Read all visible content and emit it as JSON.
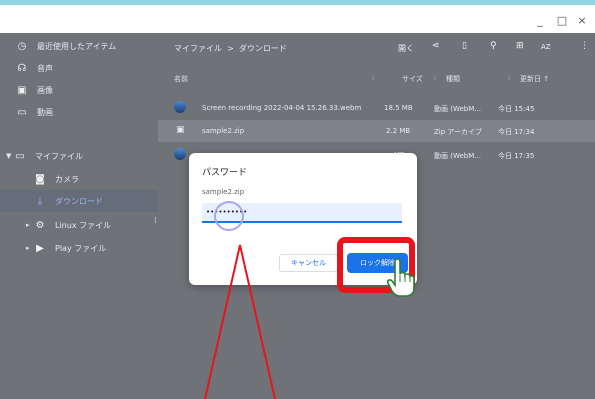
{
  "window": {
    "minimize": "_",
    "maximize": "□",
    "close": "×"
  },
  "sidebar": {
    "items": [
      {
        "label": "最近使用したアイテム",
        "icon": "clock-icon"
      },
      {
        "label": "音声",
        "icon": "headphones-icon"
      },
      {
        "label": "画像",
        "icon": "image-icon"
      },
      {
        "label": "動画",
        "icon": "video-icon"
      },
      {
        "label": "マイファイル",
        "icon": "laptop-icon"
      },
      {
        "label": "カメラ",
        "icon": "camera-icon"
      },
      {
        "label": "ダウンロード",
        "icon": "download-icon"
      },
      {
        "label": "Linux ファイル",
        "icon": "linux-icon"
      },
      {
        "label": "Play ファイル",
        "icon": "play-icon"
      }
    ]
  },
  "breadcrumb": {
    "root": "マイファイル",
    "sep": ">",
    "current": "ダウンロード"
  },
  "toolbar": {
    "open": "開く",
    "sort": "AZ"
  },
  "columns": {
    "name": "名前",
    "size": "サイズ",
    "type": "種類",
    "date": "更新日 ↑"
  },
  "files": [
    {
      "name": "Screen recording 2022-04-04 15.26.33.webm",
      "size": "18.5 MB",
      "type": "動画 (WebM...",
      "date": "今日 15:45"
    },
    {
      "name": "sample2.zip",
      "size": "2.2 MB",
      "type": "Zip アーカイブ",
      "date": "今日 17:34"
    },
    {
      "name": "",
      "size": "MB",
      "type": "動画 (WebM...",
      "date": "今日 17:35"
    }
  ],
  "dialog": {
    "title": "パスワード",
    "filename": "sample2.zip",
    "password_value": "••••••••••",
    "cancel": "キャンセル",
    "unlock": "ロック解除"
  },
  "colors": {
    "accent": "#1a73e8",
    "highlight": "#e8141c",
    "topband": "#8fd7e6"
  }
}
